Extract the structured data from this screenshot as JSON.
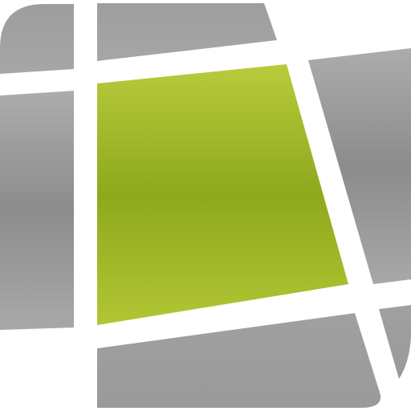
{
  "icon": {
    "name": "map-grid-app-icon",
    "colors": {
      "background": "#ffffff",
      "tile_gray_light": "#aaaaaa",
      "tile_gray_mid": "#8e8e8e",
      "tile_gray_dark": "#7d7d7d",
      "highlight_green_light": "#b8cb3c",
      "highlight_green_dark": "#8ea91d"
    }
  }
}
